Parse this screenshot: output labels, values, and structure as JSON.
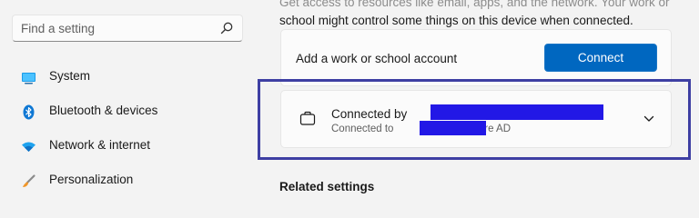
{
  "sidebar": {
    "search": {
      "placeholder": "Find a setting",
      "icon": "search-icon"
    },
    "items": [
      {
        "label": "System",
        "icon": "system-monitor-icon"
      },
      {
        "label": "Bluetooth & devices",
        "icon": "bluetooth-icon"
      },
      {
        "label": "Network & internet",
        "icon": "wifi-icon"
      },
      {
        "label": "Personalization",
        "icon": "brush-icon"
      }
    ]
  },
  "main": {
    "intro_line1": "Get access to resources like email, apps, and the network. Your work or",
    "intro_line2": "school might control some things on this device when connected.",
    "add_account": {
      "label": "Add a work or school account",
      "button": "Connect"
    },
    "connected_account": {
      "title": "Connected by",
      "subtitle_prefix": "Connected to",
      "subtitle_suffix": "Azure AD",
      "icon": "briefcase-icon",
      "expand_icon": "chevron-down-icon"
    },
    "related_settings": "Related settings"
  },
  "colors": {
    "accent": "#0067c0",
    "redaction": "#2218e6",
    "highlight_border": "#3e3fa3"
  }
}
